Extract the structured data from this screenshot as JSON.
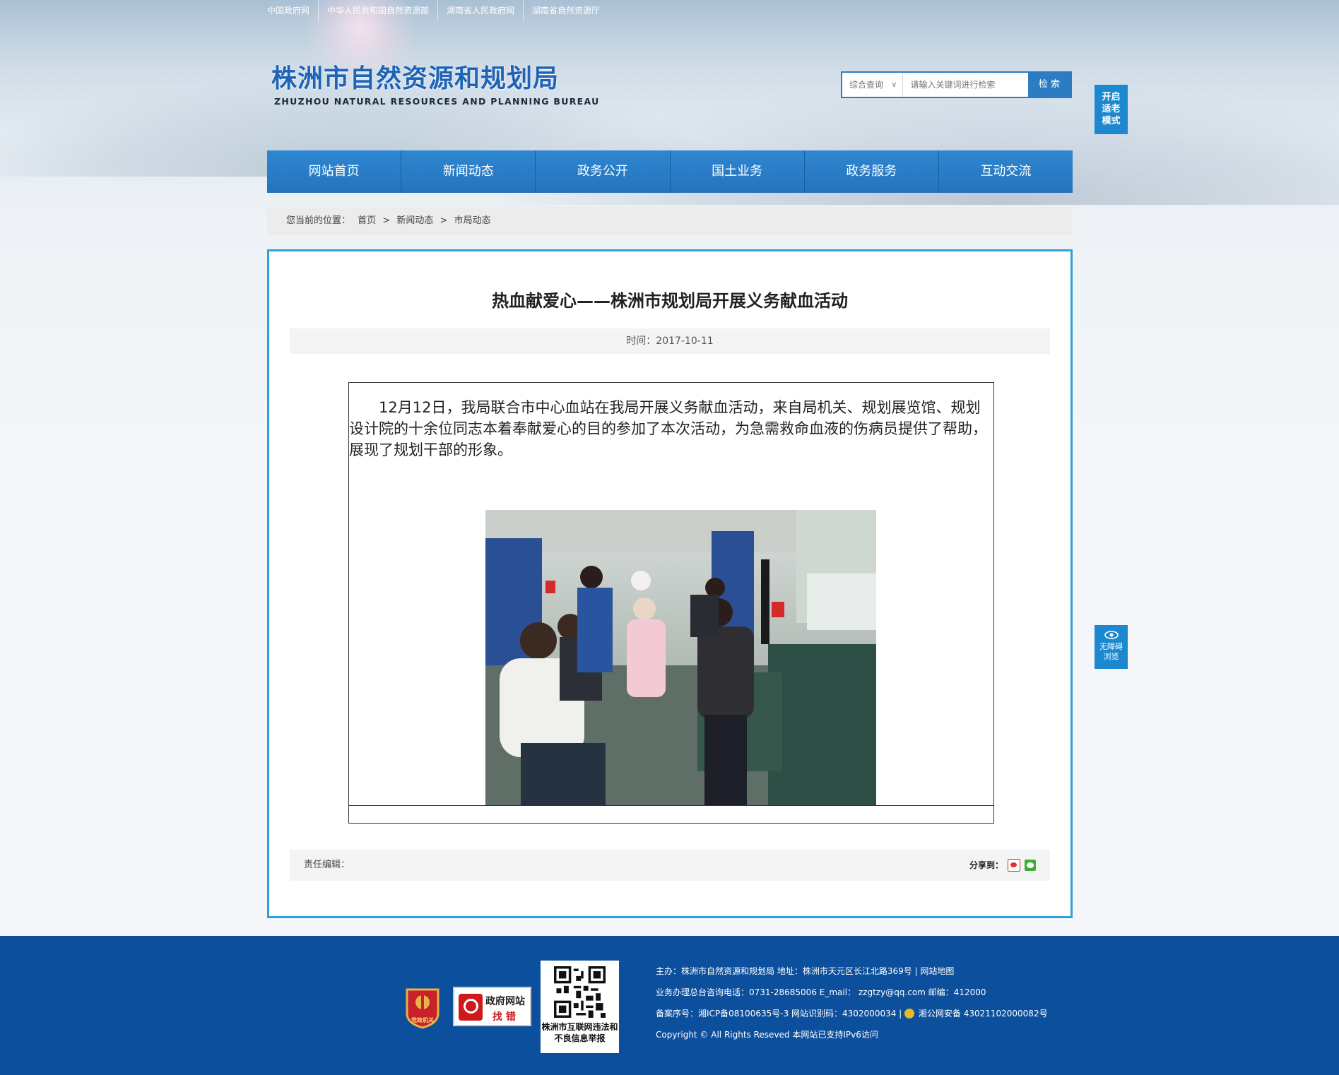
{
  "top_links": [
    "中国政府网",
    "中华人民共和国自然资源部",
    "湖南省人民政府网",
    "湖南省自然资源厅"
  ],
  "logo": {
    "cn": "株洲市自然资源和规划局",
    "en": "ZHUZHOU NATURAL RESOURCES AND PLANNING BUREAU"
  },
  "search": {
    "scope": "综合查询",
    "scope_chevron": "∨",
    "placeholder": "请输入关键词进行检索",
    "button": "检 索"
  },
  "elder_mode": "开启适老模式",
  "accessibility": "无障碍浏览",
  "nav": [
    "网站首页",
    "新闻动态",
    "政务公开",
    "国土业务",
    "政务服务",
    "互动交流"
  ],
  "breadcrumb": {
    "prefix": "您当前的位置：",
    "items": [
      "首页",
      "新闻动态",
      "市局动态"
    ],
    "separator": ">"
  },
  "article": {
    "title": "热血献爱心——株洲市规划局开展义务献血活动",
    "date": "时间：2017-10-11",
    "body": "12月12日，我局联合市中心血站在我局开展义务献血活动，来自局机关、规划展览馆、规划设计院的十余位同志本着奉献爱心的目的参加了本次活动，为急需救命血液的伤病员提供了帮助，展现了规划干部的形象。",
    "editor_label": "责任编辑：",
    "share_label": "分享到：",
    "share_icons": [
      "weibo-icon",
      "wechat-icon"
    ]
  },
  "footer": {
    "badge_text": "党政机关",
    "error_site_line1": "政府网站",
    "error_site_line2": "找 错",
    "qr_caption": "株洲市互联网违法和不良信息举报",
    "line1": "主办：株洲市自然资源和规划局   地址：株洲市天元区长江北路369号  |  网站地图",
    "line2": "业务办理总台咨询电话：0731-28685006    E_mail：  zzgtzy@qq.com     邮编：412000",
    "line3_a": "备案序号：湘ICP备08100635号-3  网站识别码：4302000034  |",
    "line3_b": "湘公网安备 43021102000082号",
    "line4": "Copyright © All Rights Reseved 本网站已支持IPv6访问"
  }
}
